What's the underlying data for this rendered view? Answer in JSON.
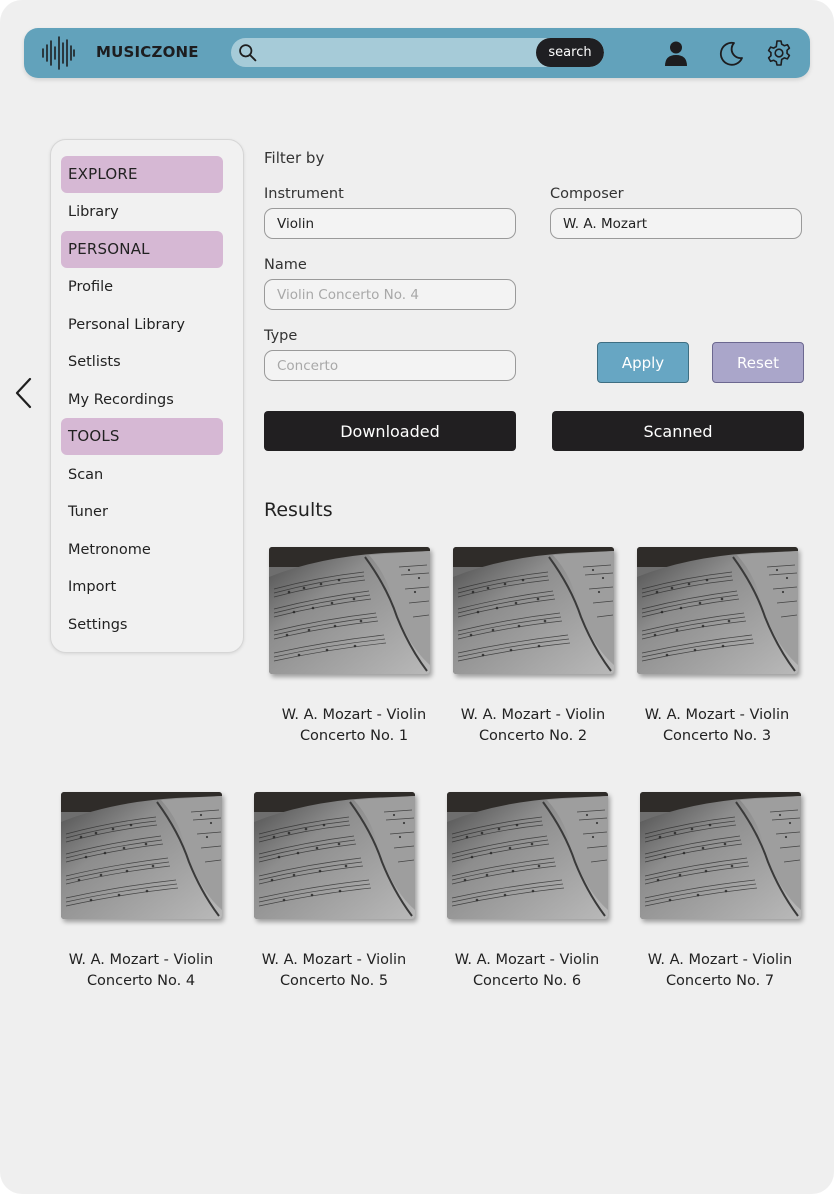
{
  "app": {
    "brand": "MUSICZONE",
    "search_placeholder": "",
    "search_button": "search",
    "colors": {
      "topbar": "#62a2bb",
      "section": "#d6b8d4",
      "apply": "#67a6c3",
      "reset": "#aaa6ca",
      "dark_button": "#211f21"
    },
    "icons": [
      "waveform-logo-icon",
      "search-icon",
      "user-icon",
      "moon-icon",
      "gear-icon",
      "chevron-left-icon"
    ]
  },
  "sidebar": {
    "explore": "EXPLORE",
    "library": "Library",
    "personal": "PERSONAL",
    "profile": "Profile",
    "personal_library": "Personal Library",
    "setlists": "Setlists",
    "my_recordings": "My Recordings",
    "tools": "TOOLS",
    "scan": "Scan",
    "tuner": "Tuner",
    "metronome": "Metronome",
    "import": "Import",
    "settings": "Settings"
  },
  "filters": {
    "heading": "Filter by",
    "instrument_label": "Instrument",
    "instrument_value": "Violin",
    "composer_label": "Composer",
    "composer_value": "W. A. Mozart",
    "name_label": "Name",
    "name_placeholder": "Violin Concerto No. 4",
    "type_label": "Type",
    "type_placeholder": "Concerto",
    "apply": "Apply",
    "reset": "Reset",
    "downloaded": "Downloaded",
    "scanned": "Scanned"
  },
  "results": {
    "heading": "Results",
    "items": [
      {
        "line1": "W. A. Mozart - Violin",
        "line2": "Concerto No. 1"
      },
      {
        "line1": "W. A. Mozart - Violin",
        "line2": "Concerto No. 2"
      },
      {
        "line1": "W. A. Mozart - Violin",
        "line2": "Concerto No. 3"
      },
      {
        "line1": "W. A. Mozart - Violin",
        "line2": "Concerto No. 4"
      },
      {
        "line1": "W. A. Mozart - Violin",
        "line2": "Concerto No. 5"
      },
      {
        "line1": "W. A. Mozart - Violin",
        "line2": "Concerto No. 6"
      },
      {
        "line1": "W. A. Mozart - Violin",
        "line2": "Concerto No. 7"
      }
    ]
  }
}
